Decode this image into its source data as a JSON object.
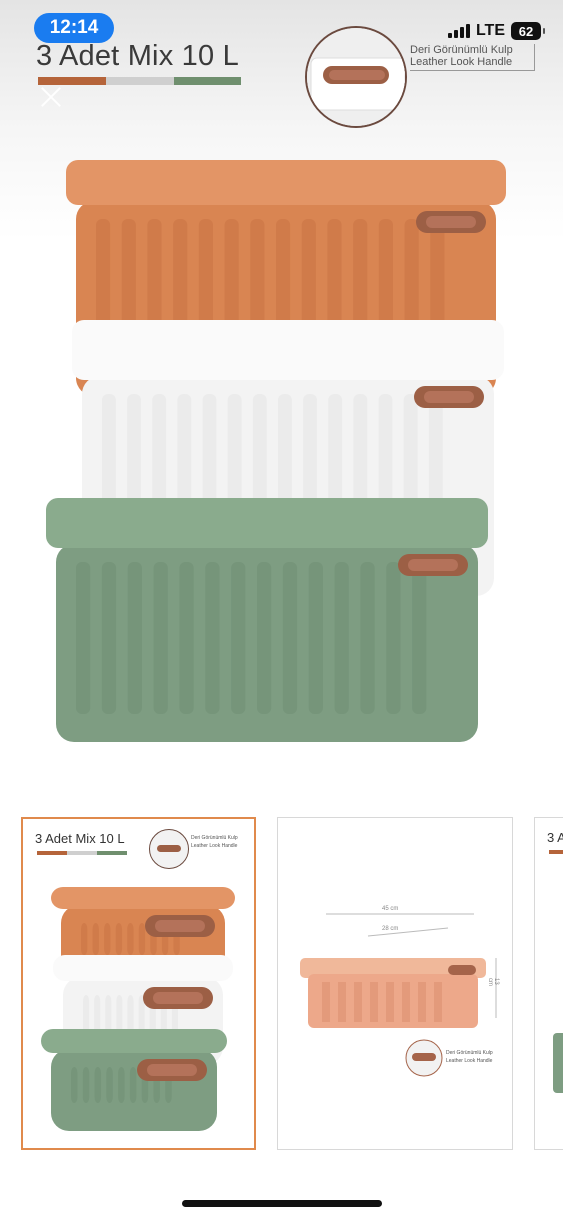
{
  "status_bar": {
    "time": "12:14",
    "network": "LTE",
    "battery": "62"
  },
  "product": {
    "title": "3 Adet Mix 10 L",
    "stripe_colors": [
      "#b5643a",
      "#c9c9c9",
      "#6f8f6e"
    ],
    "handle_label_tr": "Deri Görünümlü Kulp",
    "handle_label_en": "Leather Look Handle"
  },
  "boxes": [
    {
      "name": "orange",
      "color": "#d98552",
      "dark": "#c06a3b",
      "lid": "#e39566"
    },
    {
      "name": "white",
      "color": "#f3f3f3",
      "dark": "#dedede",
      "lid": "#fafafa"
    },
    {
      "name": "green",
      "color": "#7e9d82",
      "dark": "#67866c",
      "lid": "#8aab8d"
    }
  ],
  "thumbnails": [
    {
      "title": "3 Adet Mix 10 L",
      "handle_label_tr": "Deri Görünümlü Kulp",
      "handle_label_en": "Leather Look Handle",
      "selected": true
    },
    {
      "dimension_top": "45 cm",
      "dimension_inner": "28 cm",
      "dimension_side": "13 cm",
      "handle_label_tr": "Deri Görünümlü Kulp",
      "handle_label_en": "Leather Look Handle"
    },
    {
      "title": "3 A"
    }
  ]
}
